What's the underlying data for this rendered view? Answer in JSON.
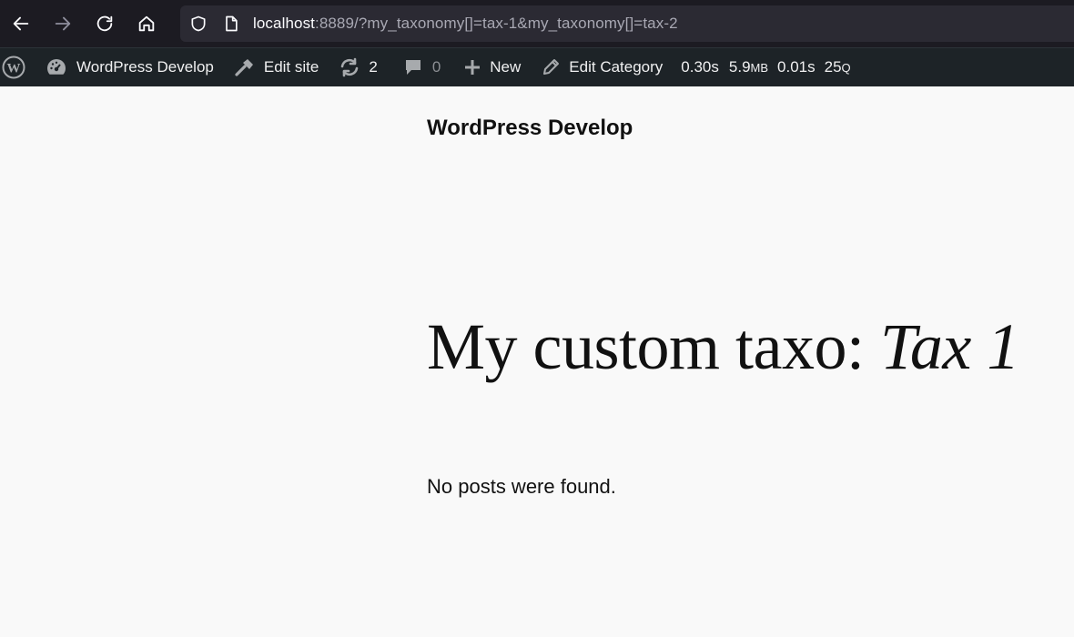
{
  "browser": {
    "url_host": "localhost",
    "url_rest": ":8889/?my_taxonomy[]=tax-1&my_taxonomy[]=tax-2"
  },
  "adminbar": {
    "site_name": "WordPress Develop",
    "edit_site": "Edit site",
    "updates_count": "2",
    "comments_count": "0",
    "new_label": "New",
    "edit_category": "Edit Category",
    "time1": "0.30s",
    "memory_value": "5.9",
    "memory_unit": "MB",
    "time2": "0.01s",
    "queries_value": "25",
    "queries_unit": "Q"
  },
  "page": {
    "site_title": "WordPress Develop",
    "archive_prefix": "My custom taxo: ",
    "archive_term": "Tax 1",
    "no_posts": "No posts were found."
  },
  "colors": {
    "browser_bg": "#1c1b22",
    "urlbar_bg": "#2b2a33",
    "adminbar_bg": "#1d2327",
    "page_bg": "#f9f9f9",
    "text": "#111111"
  }
}
